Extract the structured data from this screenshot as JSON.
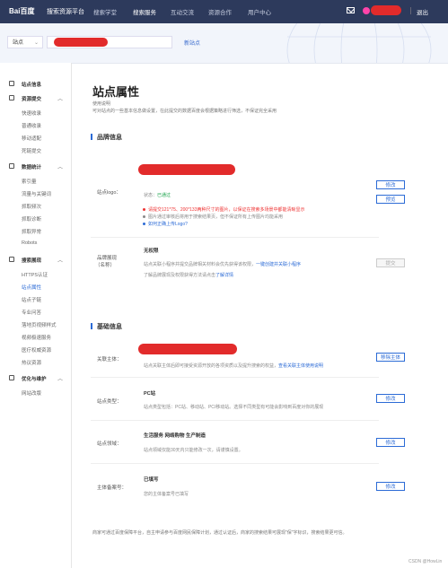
{
  "topbar": {
    "logo": "Bai百度",
    "platform": "搜索资源平台",
    "nav": [
      "搜索学堂",
      "搜索服务",
      "互动交流",
      "资源合作",
      "用户中心"
    ],
    "active_nav": 1,
    "logout": "退出"
  },
  "sitebar": {
    "site_select": "站点",
    "add_site": "新站点"
  },
  "sidebar": {
    "items": [
      {
        "label": "站点信息",
        "group": true,
        "icon": "home-icon"
      },
      {
        "label": "资源提交",
        "group": true,
        "icon": "upload-icon",
        "chev": "︿"
      },
      {
        "label": "快速收录"
      },
      {
        "label": "普通收录"
      },
      {
        "label": "移动适配"
      },
      {
        "label": "死链提交"
      },
      {
        "label": "数据统计",
        "group": true,
        "icon": "chart-icon",
        "chev": "︿"
      },
      {
        "label": "索引量"
      },
      {
        "label": "流量与关键词"
      },
      {
        "label": "抓取频次"
      },
      {
        "label": "抓取诊断"
      },
      {
        "label": "抓取异常"
      },
      {
        "label": "Robots"
      },
      {
        "label": "搜索展现",
        "group": true,
        "icon": "display-icon",
        "chev": "︿"
      },
      {
        "label": "HTTPS认证"
      },
      {
        "label": "站点属性",
        "active": true
      },
      {
        "label": "站点子链"
      },
      {
        "label": "专业问答"
      },
      {
        "label": "落地页视频样式"
      },
      {
        "label": "视频极速服务"
      },
      {
        "label": "医疗权威资源"
      },
      {
        "label": "热议资源"
      },
      {
        "label": "优化与维护",
        "group": true,
        "icon": "tool-icon",
        "chev": "︿"
      },
      {
        "label": "网站改版"
      }
    ]
  },
  "main": {
    "title": "站点属性",
    "desc_title": "使用说明",
    "desc": "可对站点的一些基本信息做设置，在此提交的数据百度会根据策略进行筛选，不保证完全采用",
    "brand_section": "品牌信息",
    "logo_label": "站点logo：",
    "logo_status_prefix": "状态：",
    "logo_status": "已通过",
    "logo_bullets": [
      "请提交121*75、200*133两种尺寸的图片，以保证在搜索多场景中都能清晰显示",
      "图片通过审核后将用于搜索结果页，但不保证所有上传图片均能采用",
      "如何正确上传Logo?"
    ],
    "btn_modify": "修改",
    "btn_preview": "预览",
    "brand_label": "品牌展现",
    "brand_label2": "（名称）",
    "brand_value": "无权限",
    "brand_desc1_prefix": "站点关联小程序并提交品牌相关材料会优先获得该权限，",
    "brand_desc1_link": "一键创建并关联小程序",
    "brand_desc2_prefix": "了解品牌展现及权限获得方法请点击",
    "brand_desc2_link": "了解详情",
    "btn_submit": "提交",
    "basic_section": "基础信息",
    "subject_label": "关联主体：",
    "subject_desc_prefix": "站点关联主体后即可接受资源开放的各项资质以及提升搜索的权益，",
    "subject_desc_link": "查看关联主体使用说明",
    "btn_unlink": "移除主体",
    "type_label": "站点类型：",
    "type_value": "PC站",
    "type_desc": "站点类型包括：PC站、移动站、PC/移动站。选择不同类型有可能会影响到百度对你的展现",
    "domain_label": "站点领域：",
    "domain_value": "生活服务 网络购物 生产制造",
    "domain_desc": "站点领域仅能30天内只能修改一次，请谨慎设置。",
    "icp_label": "主体备案号：",
    "icp_value": "已填写",
    "icp_desc": "您的主体备案号已填写",
    "footer": "商家可通过百度保障平台，自主申请参与百度网民保障计划，通过认证后，商家的搜索结果可展现\"保\"字标识，搜索结果更可信。",
    "footer_link": "百度保障平台"
  },
  "watermark": "CSDN @HowLin"
}
